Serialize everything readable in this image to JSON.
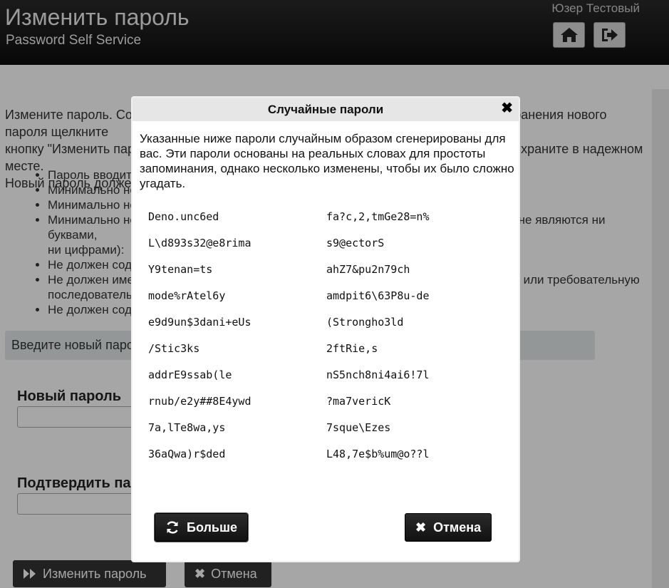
{
  "header": {
    "title": "Изменить пароль",
    "subtitle": "Password Self Service",
    "user": "Юзер Тестовый"
  },
  "page": {
    "intro_line1": "Измените пароль. Созданный пароль должен соответствовать требованиям. Для сохранения нового пароля щелкните",
    "intro_line2": "кнопку \"Изменить пароль\". Если вы опасаетесь забыть новый пароль, запишите его и храните в надежном месте.",
    "intro_line3": "Новый пароль должен соответствовать следующим требованиям:",
    "rules": [
      "Пароль вводится с учетом регистра",
      "Минимально необходимая длина пароля",
      "Минимально необходимое количество символов",
      "Минимально необходимое количество специальных символов (символов, которые не являются ни буквами,",
      "Не должен содержать часть имени",
      "Не должен иметь в составе последовательности символов, образующих кириллицу или требовательную",
      "Не должен содержать часть пароля"
    ],
    "rule4_cont": "ни цифрами):",
    "rule6_cont": "последовательность",
    "section_prompt": "Введите новый пароль",
    "new_password_label": "Новый пароль",
    "confirm_password_label": "Подтвердить пароль",
    "change_button": "Изменить пароль",
    "cancel_button": "Отмена"
  },
  "modal": {
    "title": "Случайные пароли",
    "description": "Указанные ниже пароли случайным образом сгенерированы для вас. Эти пароли основаны на реальных словах для простоты запоминания, однако несколько изменены, чтобы их было сложно угадать.",
    "passwords": [
      [
        "Deno.unc6ed",
        "fa?c,2,tmGe28=n%"
      ],
      [
        "L\\d893s32@e8rima",
        "s9@ectorS"
      ],
      [
        "Y9tenan=ts",
        "ahZ7&pu2n79ch"
      ],
      [
        "mode%rAtel6y",
        "amdpit6\\63P8u-de"
      ],
      [
        "e9d9un$3dani+eUs",
        "(Strongho3ld"
      ],
      [
        "/Stic3ks",
        "2ftRie,s"
      ],
      [
        "addrE9ssab(le",
        "nS5nch8ni4ai6!7l"
      ],
      [
        "rnub/e2y##8E4ywd",
        "?ma7vericK"
      ],
      [
        "7a,lTe8wa,ys",
        "7sque\\Ezes"
      ],
      [
        "36aQwa)r$ded",
        "L48,7e$b%um@o??l"
      ]
    ],
    "more_button": "Больше",
    "cancel_button": "Отмена",
    "close_symbol": "✖"
  }
}
